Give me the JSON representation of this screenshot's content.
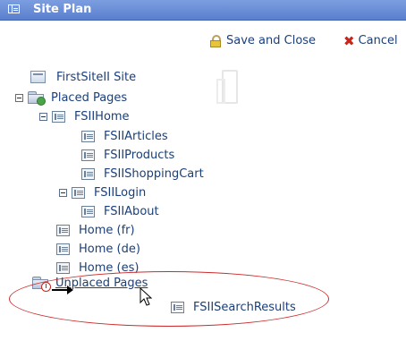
{
  "window": {
    "title": "Site Plan"
  },
  "toolbar": {
    "save_label": "Save and Close",
    "cancel_label": "Cancel"
  },
  "tree": {
    "root": {
      "label": "FirstSiteII Site"
    },
    "placed": {
      "label": "Placed Pages",
      "children": [
        {
          "label": "FSIIHome"
        },
        {
          "label": "FSIIArticles"
        },
        {
          "label": "FSIIProducts"
        },
        {
          "label": "FSIIShoppingCart"
        },
        {
          "label": "FSIILogin"
        },
        {
          "label": "FSIIAbout"
        },
        {
          "label": "Home (fr)"
        },
        {
          "label": "Home (de)"
        },
        {
          "label": "Home (es)"
        }
      ]
    },
    "unplaced": {
      "label": "Unplaced Pages",
      "children": [
        {
          "label": "FSIISearchResults"
        }
      ]
    }
  },
  "colors": {
    "accent": "#1a3f7a",
    "titlebar": "#6a8ed8",
    "highlight": "#cc2b2b",
    "cancel_icon": "#c8251b"
  },
  "icons": [
    "page-icon",
    "folder-icon",
    "lock-icon",
    "close-x-icon",
    "site-icon",
    "collapse-toggle-icon",
    "mouse-cursor-icon",
    "arrow-icon"
  ]
}
